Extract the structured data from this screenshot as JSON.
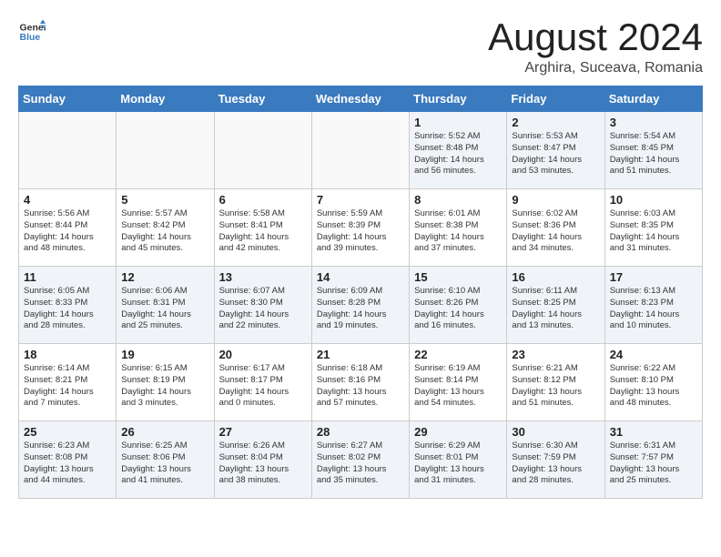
{
  "header": {
    "logo_general": "General",
    "logo_blue": "Blue",
    "title": "August 2024",
    "subtitle": "Arghira, Suceava, Romania"
  },
  "days_of_week": [
    "Sunday",
    "Monday",
    "Tuesday",
    "Wednesday",
    "Thursday",
    "Friday",
    "Saturday"
  ],
  "weeks": [
    [
      {
        "day": "",
        "info": ""
      },
      {
        "day": "",
        "info": ""
      },
      {
        "day": "",
        "info": ""
      },
      {
        "day": "",
        "info": ""
      },
      {
        "day": "1",
        "info": "Sunrise: 5:52 AM\nSunset: 8:48 PM\nDaylight: 14 hours\nand 56 minutes."
      },
      {
        "day": "2",
        "info": "Sunrise: 5:53 AM\nSunset: 8:47 PM\nDaylight: 14 hours\nand 53 minutes."
      },
      {
        "day": "3",
        "info": "Sunrise: 5:54 AM\nSunset: 8:45 PM\nDaylight: 14 hours\nand 51 minutes."
      }
    ],
    [
      {
        "day": "4",
        "info": "Sunrise: 5:56 AM\nSunset: 8:44 PM\nDaylight: 14 hours\nand 48 minutes."
      },
      {
        "day": "5",
        "info": "Sunrise: 5:57 AM\nSunset: 8:42 PM\nDaylight: 14 hours\nand 45 minutes."
      },
      {
        "day": "6",
        "info": "Sunrise: 5:58 AM\nSunset: 8:41 PM\nDaylight: 14 hours\nand 42 minutes."
      },
      {
        "day": "7",
        "info": "Sunrise: 5:59 AM\nSunset: 8:39 PM\nDaylight: 14 hours\nand 39 minutes."
      },
      {
        "day": "8",
        "info": "Sunrise: 6:01 AM\nSunset: 8:38 PM\nDaylight: 14 hours\nand 37 minutes."
      },
      {
        "day": "9",
        "info": "Sunrise: 6:02 AM\nSunset: 8:36 PM\nDaylight: 14 hours\nand 34 minutes."
      },
      {
        "day": "10",
        "info": "Sunrise: 6:03 AM\nSunset: 8:35 PM\nDaylight: 14 hours\nand 31 minutes."
      }
    ],
    [
      {
        "day": "11",
        "info": "Sunrise: 6:05 AM\nSunset: 8:33 PM\nDaylight: 14 hours\nand 28 minutes."
      },
      {
        "day": "12",
        "info": "Sunrise: 6:06 AM\nSunset: 8:31 PM\nDaylight: 14 hours\nand 25 minutes."
      },
      {
        "day": "13",
        "info": "Sunrise: 6:07 AM\nSunset: 8:30 PM\nDaylight: 14 hours\nand 22 minutes."
      },
      {
        "day": "14",
        "info": "Sunrise: 6:09 AM\nSunset: 8:28 PM\nDaylight: 14 hours\nand 19 minutes."
      },
      {
        "day": "15",
        "info": "Sunrise: 6:10 AM\nSunset: 8:26 PM\nDaylight: 14 hours\nand 16 minutes."
      },
      {
        "day": "16",
        "info": "Sunrise: 6:11 AM\nSunset: 8:25 PM\nDaylight: 14 hours\nand 13 minutes."
      },
      {
        "day": "17",
        "info": "Sunrise: 6:13 AM\nSunset: 8:23 PM\nDaylight: 14 hours\nand 10 minutes."
      }
    ],
    [
      {
        "day": "18",
        "info": "Sunrise: 6:14 AM\nSunset: 8:21 PM\nDaylight: 14 hours\nand 7 minutes."
      },
      {
        "day": "19",
        "info": "Sunrise: 6:15 AM\nSunset: 8:19 PM\nDaylight: 14 hours\nand 3 minutes."
      },
      {
        "day": "20",
        "info": "Sunrise: 6:17 AM\nSunset: 8:17 PM\nDaylight: 14 hours\nand 0 minutes."
      },
      {
        "day": "21",
        "info": "Sunrise: 6:18 AM\nSunset: 8:16 PM\nDaylight: 13 hours\nand 57 minutes."
      },
      {
        "day": "22",
        "info": "Sunrise: 6:19 AM\nSunset: 8:14 PM\nDaylight: 13 hours\nand 54 minutes."
      },
      {
        "day": "23",
        "info": "Sunrise: 6:21 AM\nSunset: 8:12 PM\nDaylight: 13 hours\nand 51 minutes."
      },
      {
        "day": "24",
        "info": "Sunrise: 6:22 AM\nSunset: 8:10 PM\nDaylight: 13 hours\nand 48 minutes."
      }
    ],
    [
      {
        "day": "25",
        "info": "Sunrise: 6:23 AM\nSunset: 8:08 PM\nDaylight: 13 hours\nand 44 minutes."
      },
      {
        "day": "26",
        "info": "Sunrise: 6:25 AM\nSunset: 8:06 PM\nDaylight: 13 hours\nand 41 minutes."
      },
      {
        "day": "27",
        "info": "Sunrise: 6:26 AM\nSunset: 8:04 PM\nDaylight: 13 hours\nand 38 minutes."
      },
      {
        "day": "28",
        "info": "Sunrise: 6:27 AM\nSunset: 8:02 PM\nDaylight: 13 hours\nand 35 minutes."
      },
      {
        "day": "29",
        "info": "Sunrise: 6:29 AM\nSunset: 8:01 PM\nDaylight: 13 hours\nand 31 minutes."
      },
      {
        "day": "30",
        "info": "Sunrise: 6:30 AM\nSunset: 7:59 PM\nDaylight: 13 hours\nand 28 minutes."
      },
      {
        "day": "31",
        "info": "Sunrise: 6:31 AM\nSunset: 7:57 PM\nDaylight: 13 hours\nand 25 minutes."
      }
    ]
  ]
}
